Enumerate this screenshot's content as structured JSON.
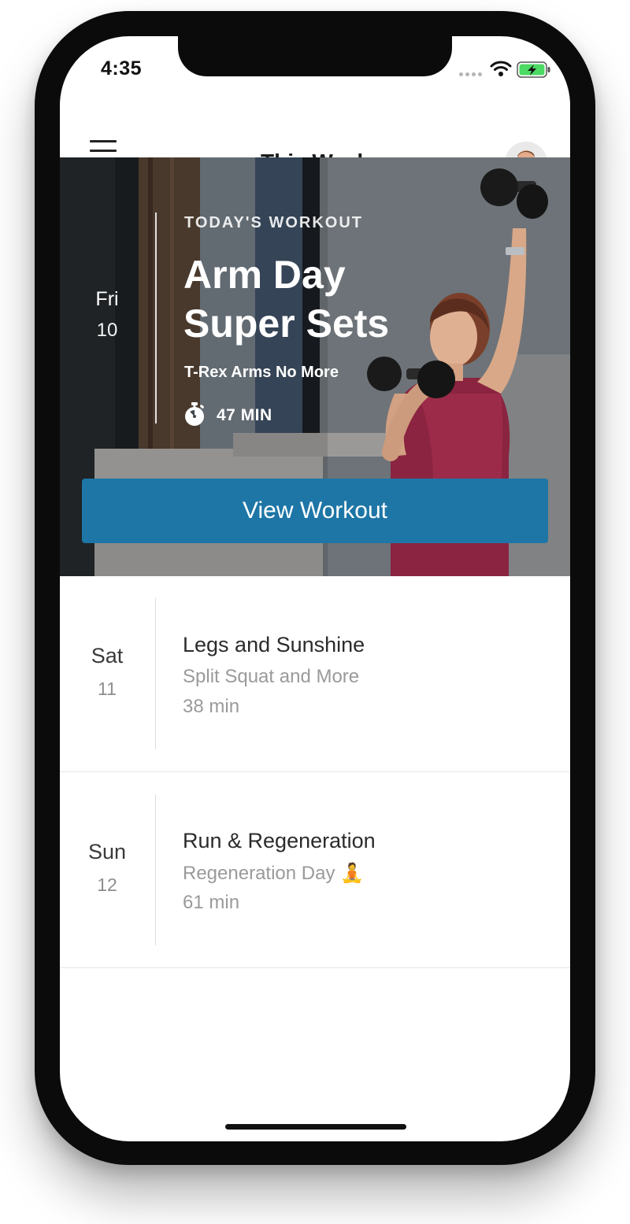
{
  "status_bar": {
    "time": "4:35",
    "icons": [
      "signal-dots-icon",
      "wifi-icon",
      "battery-charging-icon"
    ],
    "battery_color": "#4cd964"
  },
  "nav": {
    "title": "This Week",
    "menu_icon": "hamburger-menu-icon",
    "avatar": "user-avatar"
  },
  "today": {
    "day": "Fri",
    "date": "10",
    "kicker": "TODAY'S WORKOUT",
    "title": "Arm Day Super Sets",
    "subtitle": "T-Rex Arms No More",
    "duration": "47 MIN",
    "duration_icon": "stopwatch-icon",
    "button_label": "View Workout",
    "accent": "#1d76a6"
  },
  "upcoming": [
    {
      "day": "Sat",
      "date": "11",
      "title": "Legs and Sunshine",
      "subtitle": "Split Squat and More",
      "duration": "38 min"
    },
    {
      "day": "Sun",
      "date": "12",
      "title": "Run & Regeneration",
      "subtitle": "Regeneration Day 🧘",
      "duration": "61 min"
    }
  ]
}
